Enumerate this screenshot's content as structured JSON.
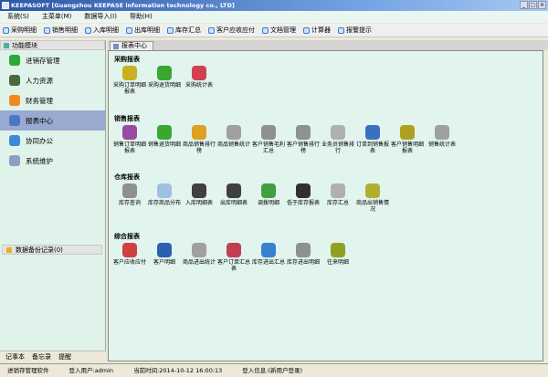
{
  "window": {
    "title": "KEEPASOFT [Guangzhou KEEPASE information technology co., LTD]"
  },
  "menu": [
    "系统(S)",
    "主菜单(M)",
    "数据导入(I)",
    "帮助(H)"
  ],
  "toolbar": [
    "采购明细",
    "销售明细",
    "入库明细",
    "出库明细",
    "库存汇总",
    "客户应收应付",
    "文档管理",
    "计算器",
    "报警提示"
  ],
  "sidebar": {
    "header": "功能模块",
    "items": [
      {
        "label": "进销存管理",
        "color": "#2fa83a"
      },
      {
        "label": "人力资源",
        "color": "#4a6a3a"
      },
      {
        "label": "财务管理",
        "color": "#f08a1c"
      },
      {
        "label": "报表中心",
        "color": "#4a78c8",
        "selected": true
      },
      {
        "label": "协同办公",
        "color": "#3a8ad8"
      },
      {
        "label": "系统维护",
        "color": "#8aa0c0"
      }
    ],
    "backup": "数据备份记录(0)",
    "bottom_tabs": [
      "记事本",
      "备忘录",
      "提醒"
    ]
  },
  "tab": "报表中心",
  "sections": [
    {
      "title": "采购报表",
      "items": [
        {
          "label": "采购订单明细报表",
          "color": "#c8b020"
        },
        {
          "label": "采购退货明细",
          "color": "#3aa830"
        },
        {
          "label": "采购统计表",
          "color": "#d04050"
        }
      ]
    },
    {
      "title": "销售报表",
      "items": [
        {
          "label": "销售订单明细报表",
          "color": "#9a4aa0"
        },
        {
          "label": "销售退货明细",
          "color": "#3aa830"
        },
        {
          "label": "商品销售排行榜",
          "color": "#e0a020"
        },
        {
          "label": "商品销售统计",
          "color": "#a0a0a0"
        },
        {
          "label": "客户销售毛利汇总",
          "color": "#909090"
        },
        {
          "label": "客户销售排行榜",
          "color": "#909090"
        },
        {
          "label": "业务员销售排行",
          "color": "#b0b0b0"
        },
        {
          "label": "订单到销售报表",
          "color": "#3a70c0"
        },
        {
          "label": "客户销售明细报表",
          "color": "#b0a020"
        },
        {
          "label": "销售统计表",
          "color": "#a0a0a0"
        }
      ]
    },
    {
      "title": "仓库报表",
      "items": [
        {
          "label": "库存查询",
          "color": "#909090"
        },
        {
          "label": "库存商品分布",
          "color": "#a0c0e0"
        },
        {
          "label": "入库明细表",
          "color": "#404040"
        },
        {
          "label": "出库明细表",
          "color": "#404040"
        },
        {
          "label": "调拨明细",
          "color": "#40a040"
        },
        {
          "label": "低于库存报表",
          "color": "#303030"
        },
        {
          "label": "库存汇总",
          "color": "#b0b0b0"
        },
        {
          "label": "商品出销售情况",
          "color": "#b0b030"
        }
      ]
    },
    {
      "title": "综合报表",
      "items": [
        {
          "label": "客户应收应付",
          "color": "#d04040"
        },
        {
          "label": "客户明细",
          "color": "#2a60b0"
        },
        {
          "label": "商品进出统计",
          "color": "#a0a0a0"
        },
        {
          "label": "客户订单汇总表",
          "color": "#c04050"
        },
        {
          "label": "库存进出汇总",
          "color": "#3a80d0"
        },
        {
          "label": "库存进出明细",
          "color": "#909090"
        },
        {
          "label": "往来明细",
          "color": "#90a020"
        }
      ]
    }
  ],
  "status": [
    "进销存管理软件",
    "登入用户:admin",
    "当前时间:2014-10-12 16:00:13",
    "登入信息:(新用户登录)"
  ]
}
